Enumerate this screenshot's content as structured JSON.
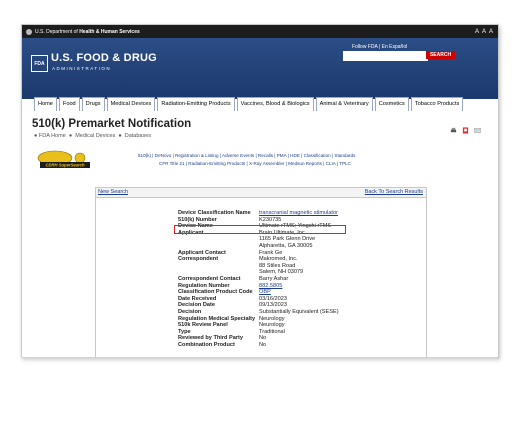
{
  "hhs_bar": {
    "prefix": "U.S. Department of",
    "dept": "Health & Human Services",
    "size_controls": "A A A"
  },
  "header": {
    "logo": "FDA",
    "name": "U.S. FOOD & DRUG",
    "sub": "ADMINISTRATION",
    "top_links": "Follow FDA  |  En Español",
    "search_button": "SEARCH",
    "search_placeholder": ""
  },
  "nav": [
    "Home",
    "Food",
    "Drugs",
    "Medical Devices",
    "Radiation-Emitting Products",
    "Vaccines, Blood & Biologics",
    "Animal & Veterinary",
    "Cosmetics",
    "Tobacco Products"
  ],
  "page": {
    "title": "510(k) Premarket Notification",
    "breadcrumb": [
      "FDA Home",
      "Medical Devices",
      "Databases"
    ]
  },
  "subnav": {
    "logo_text": "CDRH SuperSearch",
    "line1": "510(k)  |  DeNovo  |  Registration & Listing  |  Adverse Events  |  Recalls  |  PMA  |  HDE  |  Classification  |  Standards",
    "line2": "CFR Title 21  |  Radiation-Emitting Products  |  X-Ray Assembler  |  Medsun Reports  |  CLIA  |  TPLC"
  },
  "results": {
    "new_search": "New Search",
    "back": "Back To Search Results",
    "rows": [
      {
        "label": "Device Classification Name",
        "value": "transcranial magnetic stimulator",
        "link": true
      },
      {
        "label": "510(k) Number",
        "value": "K230735",
        "link": false
      },
      {
        "label": "Device Name",
        "value": "Ultimate rTMS; Yingchi rTMS",
        "link": false
      },
      {
        "label": "Applicant",
        "value": "Brain Ultimate, Inc.",
        "link": false
      },
      {
        "label": "",
        "value": "1165 Park Glenn Drive",
        "link": false
      },
      {
        "label": "",
        "value": "Alpharetta,  GA  30005",
        "link": false
      },
      {
        "label": "Applicant Contact",
        "value": "Frank Ge",
        "link": false
      },
      {
        "label": "Correspondent",
        "value": "Makromed, Inc.",
        "link": false
      },
      {
        "label": "",
        "value": "88 Stiles Road",
        "link": false
      },
      {
        "label": "",
        "value": "Salem,  NH  03079",
        "link": false
      },
      {
        "label": "Correspondent Contact",
        "value": "Barry Ashar",
        "link": false
      },
      {
        "label": "Regulation Number",
        "value": "882.5805",
        "link": true
      },
      {
        "label": "Classification Product Code",
        "value": "OBP",
        "link": true
      },
      {
        "label": "Date Received",
        "value": "03/16/2023",
        "link": false
      },
      {
        "label": "Decision Date",
        "value": "09/13/2023",
        "link": false
      },
      {
        "label": "Decision",
        "value": "Substantially Equivalent (SESE)",
        "link": false
      },
      {
        "label": "Regulation Medical Specialty",
        "value": "Neurology",
        "link": false
      },
      {
        "label": "510k Review Panel",
        "value": "Neurology",
        "link": false
      },
      {
        "label": "Type",
        "value": "Traditional",
        "link": false
      },
      {
        "label": "Reviewed by Third Party",
        "value": "No",
        "link": false
      },
      {
        "label": "Combination Product",
        "value": "No",
        "link": false
      }
    ]
  },
  "colors": {
    "header_blue": "#1d3a6e",
    "search_red": "#cc0000",
    "highlight_red": "#dd2222",
    "link_blue": "#1a3d8f"
  }
}
